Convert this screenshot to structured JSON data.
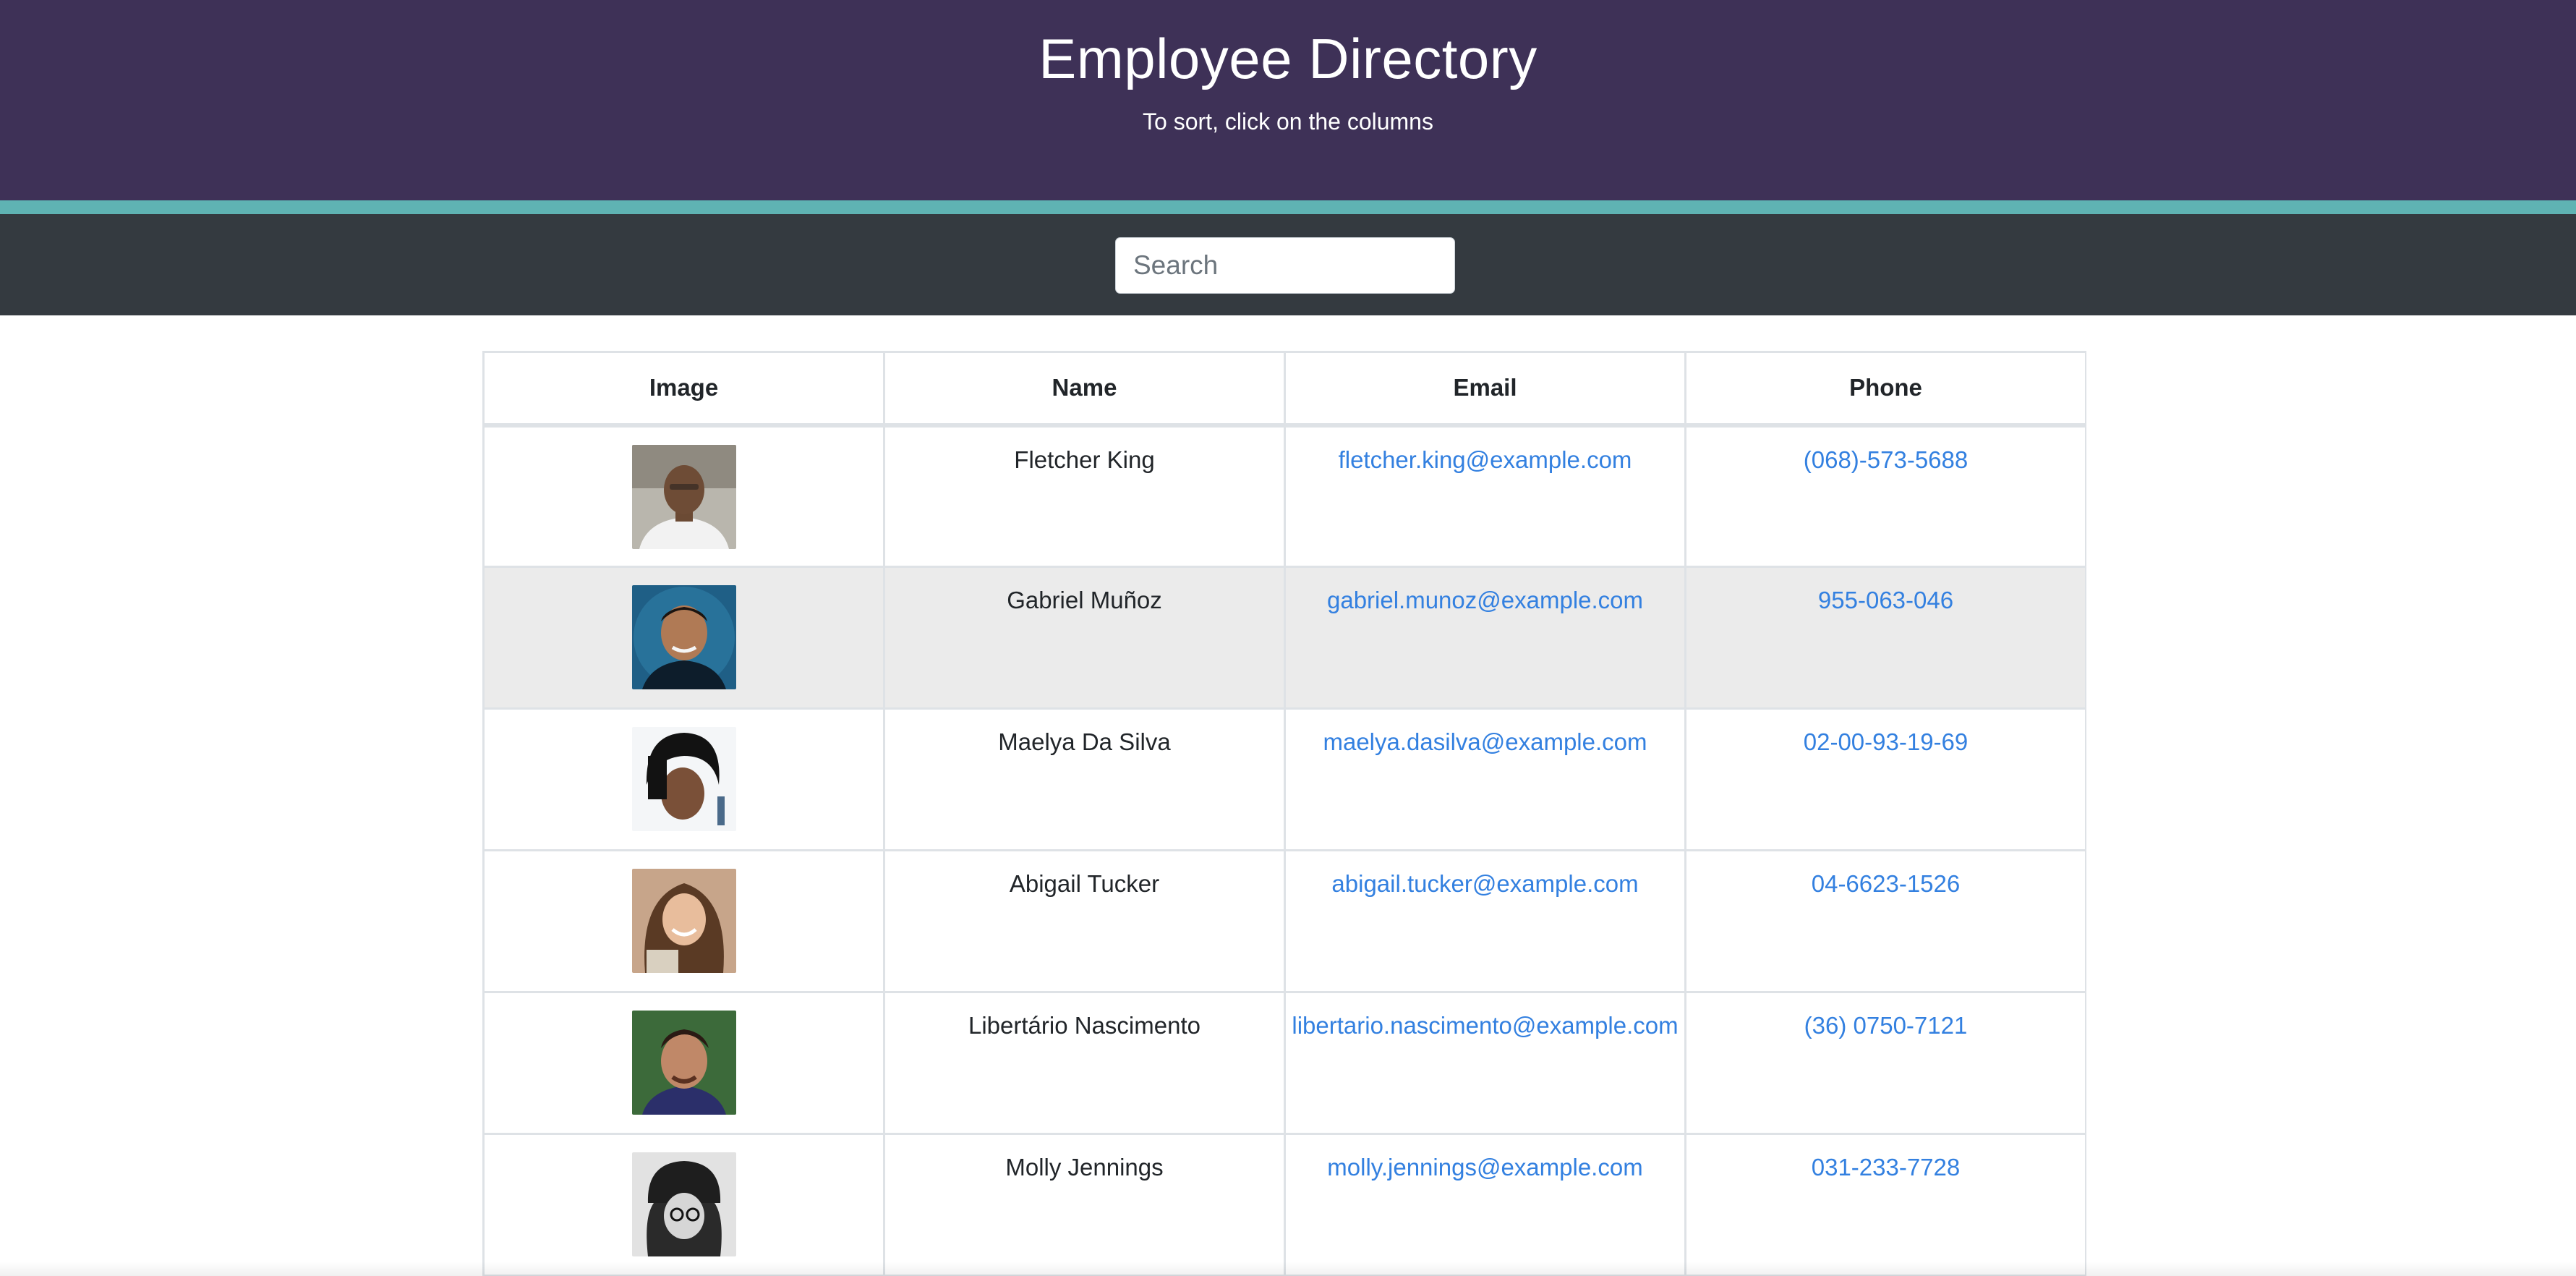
{
  "header": {
    "title": "Employee Directory",
    "subtitle": "To sort, click on the columns"
  },
  "search": {
    "placeholder": "Search",
    "value": ""
  },
  "table": {
    "columns": [
      "Image",
      "Name",
      "Email",
      "Phone"
    ],
    "rows": [
      {
        "name": "Fletcher King",
        "email": "fletcher.king@example.com",
        "phone": "(068)-573-5688",
        "avatar": "man-smiling-white-shirt-photo"
      },
      {
        "name": "Gabriel Muñoz",
        "email": "gabriel.munoz@example.com",
        "phone": "955-063-046",
        "avatar": "man-smiling-blue-background-photo"
      },
      {
        "name": "Maelya Da Silva",
        "email": "maelya.dasilva@example.com",
        "phone": "02-00-93-19-69",
        "avatar": "woman-dark-hair-photo"
      },
      {
        "name": "Abigail Tucker",
        "email": "abigail.tucker@example.com",
        "phone": "04-6623-1526",
        "avatar": "woman-smiling-brown-hair-photo"
      },
      {
        "name": "Libertário Nascimento",
        "email": "libertario.nascimento@example.com",
        "phone": "(36) 0750-7121",
        "avatar": "man-green-background-photo"
      },
      {
        "name": "Molly Jennings",
        "email": "molly.jennings@example.com",
        "phone": "031-233-7728",
        "avatar": "woman-black-and-white-beanie-photo"
      }
    ]
  },
  "colors": {
    "header_bg": "#3e3157",
    "accent_bar": "#5fb3b3",
    "search_band_bg": "#343a40",
    "link": "#3380e0",
    "striped_row": "#ebebeb"
  }
}
